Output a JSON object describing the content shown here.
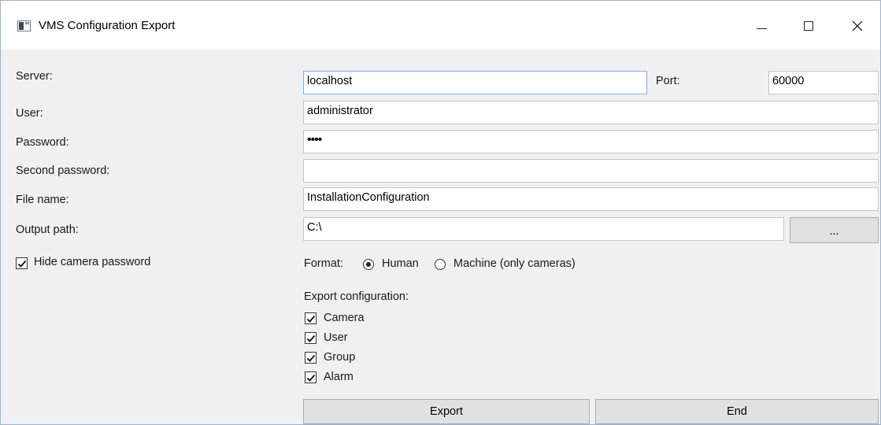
{
  "window": {
    "title": "VMS Configuration Export",
    "controls": {
      "minimize_icon": "minimize-icon",
      "maximize_icon": "maximize-icon",
      "close_icon": "close-icon"
    }
  },
  "form": {
    "server_label": "Server:",
    "server_value": "localhost",
    "port_label": "Port:",
    "port_value": "60000",
    "user_label": "User:",
    "user_value": "administrator",
    "password_label": "Password:",
    "password_value": "••••",
    "second_password_label": "Second password:",
    "second_password_value": "",
    "file_name_label": "File name:",
    "file_name_value": "InstallationConfiguration",
    "output_path_label": "Output path:",
    "output_path_value": "C:\\",
    "browse_label": "..."
  },
  "options": {
    "hide_camera_password_label": "Hide camera password",
    "hide_camera_password_checked": true,
    "format_label": "Format:",
    "format_human_label": "Human",
    "format_machine_label": "Machine (only cameras)",
    "format_selected": "Human"
  },
  "export_config": {
    "heading": "Export configuration:",
    "items": [
      {
        "label": "Camera",
        "checked": true
      },
      {
        "label": "User",
        "checked": true
      },
      {
        "label": "Group",
        "checked": true
      },
      {
        "label": "Alarm",
        "checked": true
      }
    ]
  },
  "actions": {
    "export_label": "Export",
    "end_label": "End"
  }
}
